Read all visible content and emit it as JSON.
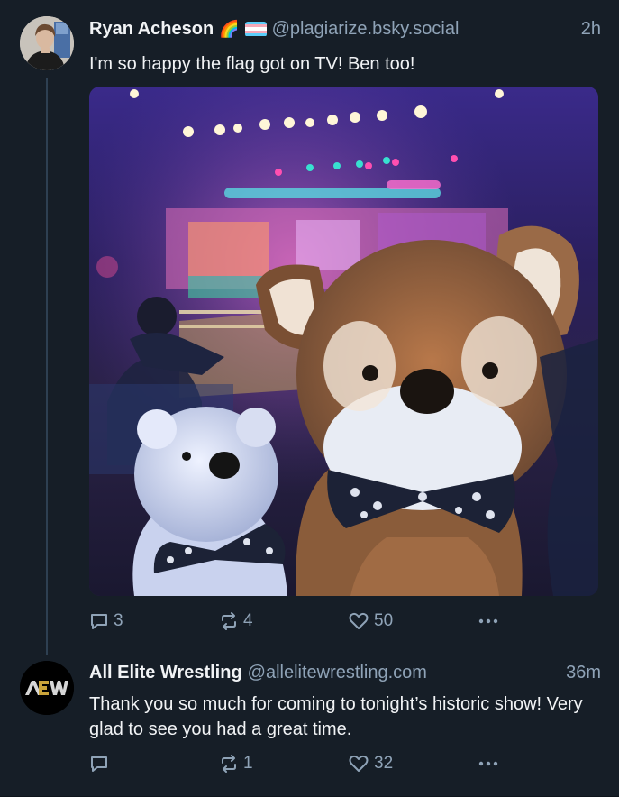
{
  "posts": [
    {
      "author": "Ryan Acheson",
      "emoji": "🌈",
      "handle": "@plagiarize.bsky.social",
      "time": "2h",
      "text": "I'm so happy the flag got on TV! Ben too!",
      "image_alt": "Two plush toys, a fox and a polar bear wearing skull-print bow ties, in front of a lit wrestling arena stage",
      "replies": "3",
      "reposts": "4",
      "likes": "50"
    },
    {
      "author": "All Elite Wrestling",
      "handle": "@allelitewrestling.com",
      "time": "36m",
      "text": "Thank you so much for coming to tonight’s historic show! Very glad to see you had a great time.",
      "avatar_logo": "AEW",
      "replies": "",
      "reposts": "1",
      "likes": "32"
    }
  ],
  "colors": {
    "background": "#161e27",
    "muted": "#8fa3b7",
    "text": "#f1f3f5",
    "thread_line": "#2e4052",
    "aew_gold": "#c9a33a"
  },
  "icons": [
    "reply-icon",
    "repost-icon",
    "like-icon",
    "more-icon"
  ]
}
